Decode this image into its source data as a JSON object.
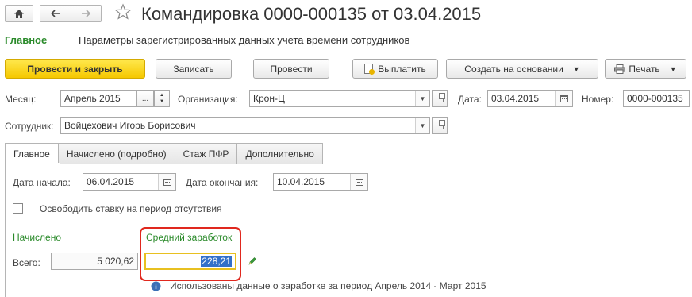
{
  "header": {
    "title": "Командировка 0000-000135 от 03.04.2015"
  },
  "subnav": {
    "main": "Главное",
    "params": "Параметры зарегистрированных данных учета времени сотрудников"
  },
  "toolbar": {
    "post_close": "Провести и закрыть",
    "save": "Записать",
    "post": "Провести",
    "pay": "Выплатить",
    "create_based": "Создать на основании",
    "print": "Печать"
  },
  "form": {
    "month_label": "Месяц:",
    "month_value": "Апрель 2015",
    "month_dots": "...",
    "org_label": "Организация:",
    "org_value": "Крон-Ц",
    "date_label": "Дата:",
    "date_value": "03.04.2015",
    "number_label": "Номер:",
    "number_value": "0000-000135",
    "employee_label": "Сотрудник:",
    "employee_value": "Войцехович Игорь Борисович"
  },
  "tabs": [
    "Главное",
    "Начислено (подробно)",
    "Стаж ПФР",
    "Дополнительно"
  ],
  "main_tab": {
    "start_label": "Дата начала:",
    "start_value": "06.04.2015",
    "end_label": "Дата окончания:",
    "end_value": "10.04.2015",
    "free_rate_label": "Освободить ставку на период отсутствия",
    "free_rate_checked": false,
    "accrued_title": "Начислено",
    "avg_title": "Средний заработок",
    "total_label": "Всего:",
    "total_value": "5 020,62",
    "avg_value": "228,21",
    "info_text": "Использованы данные о заработке за период Апрель 2014 - Март 2015"
  },
  "colors": {
    "accent_green": "#2a8a2a",
    "primary_yellow": "#f5c800",
    "highlight_red": "#e0281e",
    "field_focus": "#e8c020"
  }
}
